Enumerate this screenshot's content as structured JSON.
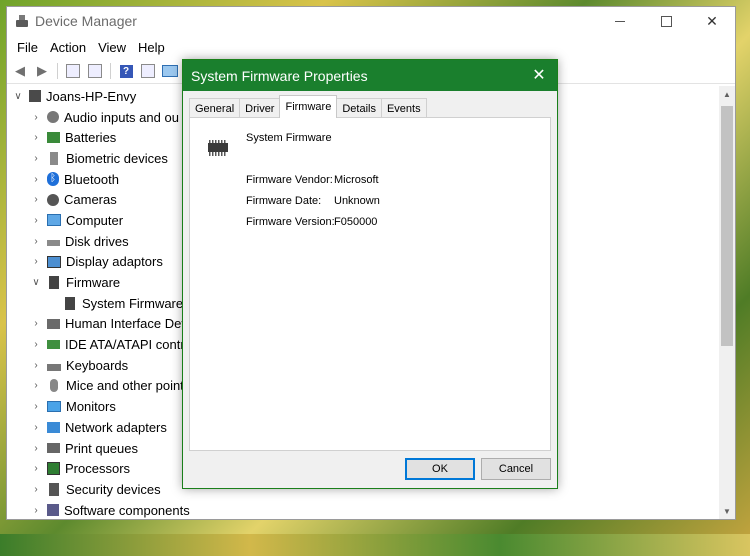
{
  "device_manager": {
    "title": "Device Manager",
    "menu": [
      "File",
      "Action",
      "View",
      "Help"
    ],
    "tree": {
      "root": "Joans-HP-Envy",
      "items": [
        {
          "label": "Audio inputs and ou",
          "icon": "speaker-icon",
          "expanded": false
        },
        {
          "label": "Batteries",
          "icon": "battery-icon",
          "expanded": false
        },
        {
          "label": "Biometric devices",
          "icon": "fingerprint-icon",
          "expanded": false
        },
        {
          "label": "Bluetooth",
          "icon": "bluetooth-icon",
          "expanded": false
        },
        {
          "label": "Cameras",
          "icon": "camera-icon",
          "expanded": false
        },
        {
          "label": "Computer",
          "icon": "computer-icon",
          "expanded": false
        },
        {
          "label": "Disk drives",
          "icon": "disk-drive-icon",
          "expanded": false
        },
        {
          "label": "Display adaptors",
          "icon": "display-adapter-icon",
          "expanded": false
        },
        {
          "label": "Firmware",
          "icon": "firmware-icon",
          "expanded": true
        },
        {
          "label": "System Firmware",
          "icon": "chip-icon",
          "child": true
        },
        {
          "label": "Human Interface Dev",
          "icon": "hid-icon",
          "expanded": false
        },
        {
          "label": "IDE ATA/ATAPI contro",
          "icon": "ide-controller-icon",
          "expanded": false
        },
        {
          "label": "Keyboards",
          "icon": "keyboard-icon",
          "expanded": false
        },
        {
          "label": "Mice and other point",
          "icon": "mouse-icon",
          "expanded": false
        },
        {
          "label": "Monitors",
          "icon": "monitor-icon",
          "expanded": false
        },
        {
          "label": "Network adapters",
          "icon": "network-adapter-icon",
          "expanded": false
        },
        {
          "label": "Print queues",
          "icon": "printer-icon",
          "expanded": false
        },
        {
          "label": "Processors",
          "icon": "processor-icon",
          "expanded": false
        },
        {
          "label": "Security devices",
          "icon": "security-device-icon",
          "expanded": false
        },
        {
          "label": "Software components",
          "icon": "software-component-icon",
          "expanded": false
        }
      ]
    }
  },
  "dialog": {
    "title": "System Firmware Properties",
    "tabs": [
      "General",
      "Driver",
      "Firmware",
      "Details",
      "Events"
    ],
    "active_tab": "Firmware",
    "device_name": "System Firmware",
    "properties": [
      {
        "label": "Firmware Vendor:",
        "value": "Microsoft"
      },
      {
        "label": "Firmware Date:",
        "value": "Unknown"
      },
      {
        "label": "Firmware Version:",
        "value": "F050000"
      }
    ],
    "ok_label": "OK",
    "cancel_label": "Cancel"
  },
  "colors": {
    "dialog_titlebar": "#1a7f2d",
    "ok_focus_border": "#0078d7"
  }
}
